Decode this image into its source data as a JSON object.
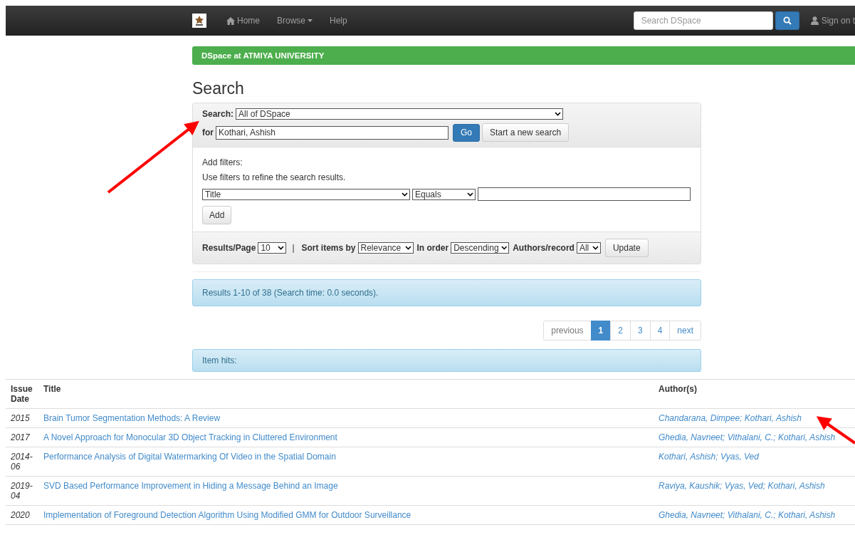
{
  "navbar": {
    "links": [
      {
        "label": "Home",
        "kind": "home"
      },
      {
        "label": "Browse",
        "kind": "dropdown"
      },
      {
        "label": "Help",
        "kind": "plain"
      }
    ],
    "search": {
      "placeholder": "Search DSpace"
    },
    "sign_on": "Sign on t"
  },
  "banner": "DSpace at ATMIYA UNIVERSITY",
  "heading": "Search",
  "search_form": {
    "scope_label": "Search:",
    "scope": "All of DSpace",
    "for_label": "for",
    "query": "Kothari, Ashish",
    "go": "Go",
    "new_search": "Start a new search"
  },
  "filters": {
    "title": "Add filters:",
    "hint": "Use filters to refine the search results.",
    "field": "Title",
    "operator": "Equals",
    "add": "Add"
  },
  "options": [
    {
      "label": "Results/Page",
      "value": "10"
    },
    {
      "label": "Sort items by",
      "value": "Relevance"
    },
    {
      "label": "In order",
      "value": "Descending"
    },
    {
      "label": "Authors/record",
      "value": "All"
    }
  ],
  "options_separator": "|",
  "update": "Update",
  "results_info": "Results 1-10 of 38 (Search time: 0.0 seconds).",
  "pagination": [
    {
      "label": "previous",
      "selected": false,
      "disabled": true
    },
    {
      "label": "1",
      "selected": true,
      "disabled": false
    },
    {
      "label": "2",
      "selected": false,
      "disabled": false
    },
    {
      "label": "3",
      "selected": false,
      "disabled": false
    },
    {
      "label": "4",
      "selected": false,
      "disabled": false
    },
    {
      "label": "next",
      "selected": false,
      "disabled": false
    }
  ],
  "item_hits": "Item hits:",
  "table": {
    "columns": [
      "Issue Date",
      "Title",
      "Author(s)"
    ],
    "rows": [
      {
        "date": "2015",
        "title": "Brain Tumor Segmentation Methods: A Review",
        "authors": "Chandarana, Dimpee; Kothari, Ashish"
      },
      {
        "date": "2017",
        "title": "A Novel Approach for Monocular 3D Object Tracking in Cluttered Environment",
        "authors": "Ghedia, Navneet; Vithalani, C.; Kothari, Ashish"
      },
      {
        "date": "2014-06",
        "title": "Performance Analysis of Digital Watermarking Of Video in the Spatial Domain",
        "authors": "Kothari, Ashish; Vyas, Ved"
      },
      {
        "date": "2019-04",
        "title": "SVD Based Performance Improvement in Hiding a Message Behind an Image",
        "authors": "Raviya, Kaushik; Vyas, Ved; Kothari, Ashish"
      },
      {
        "date": "2020",
        "title": "Implementation of Foreground Detection Algorithm Using Modified GMM for Outdoor Surveillance",
        "authors": "Ghedia, Navneet; Vithalani, C.; Kothari, Ashish"
      }
    ]
  }
}
